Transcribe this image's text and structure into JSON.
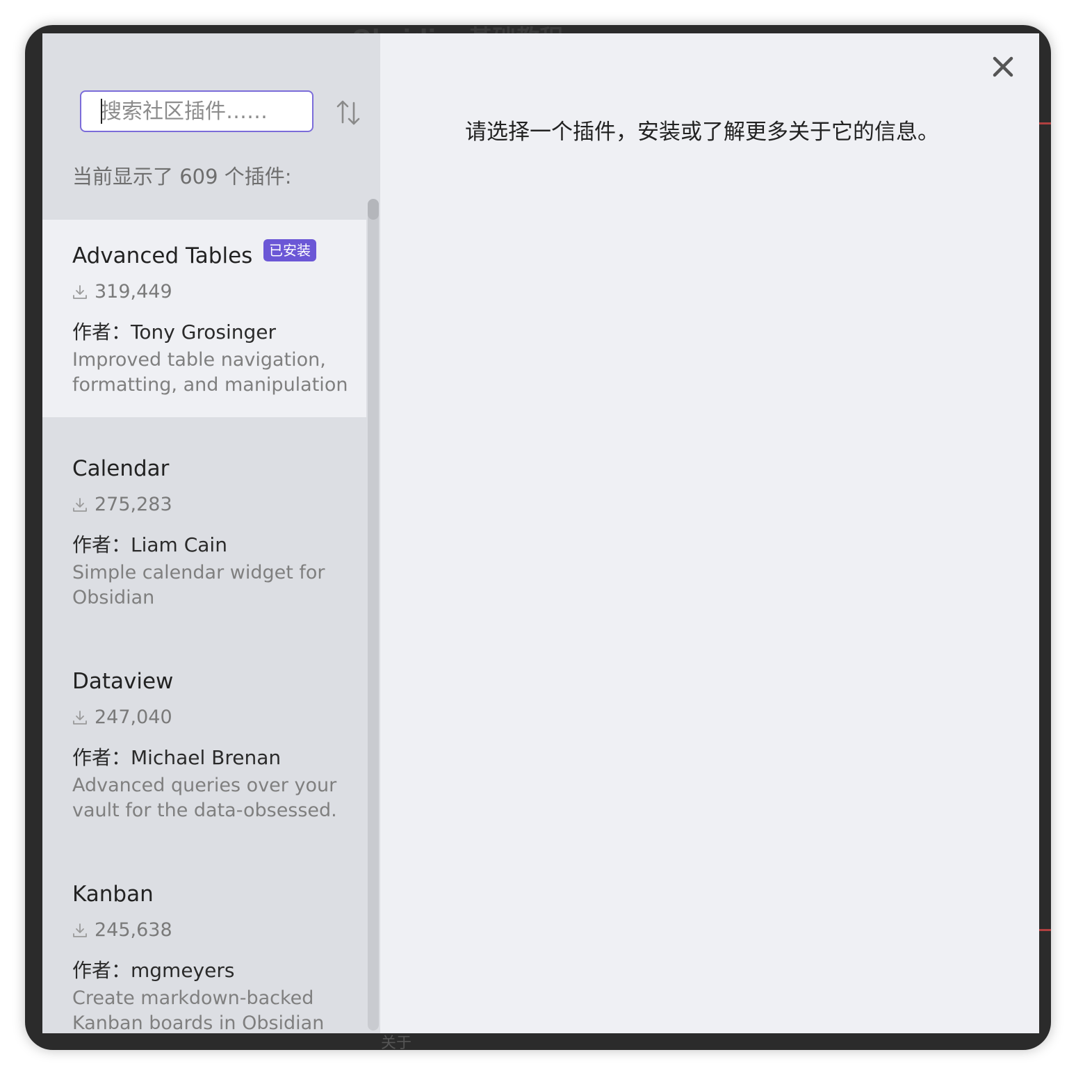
{
  "search": {
    "placeholder": "搜索社区插件……"
  },
  "list_count_text": "当前显示了 609 个插件:",
  "detail_prompt": "请选择一个插件，安装或了解更多关于它的信息。",
  "plugins": [
    {
      "name": "Advanced Tables",
      "badge": "已安装",
      "downloads": "319,449",
      "author": "作者：Tony Grosinger",
      "description": "Improved table navigation, formatting, and manipulation",
      "selected": true
    },
    {
      "name": "Calendar",
      "downloads": "275,283",
      "author": "作者：Liam Cain",
      "description": "Simple calendar widget for Obsidian"
    },
    {
      "name": "Dataview",
      "downloads": "247,040",
      "author": "作者：Michael Brenan",
      "description": "Advanced queries over your vault for the data-obsessed."
    },
    {
      "name": "Kanban",
      "downloads": "245,638",
      "author": "作者：mgmeyers",
      "description": "Create markdown-backed Kanban boards in Obsidian"
    }
  ],
  "background": {
    "title": "Obsidian基础教程",
    "bottom_label": "关于"
  },
  "colors": {
    "accent": "#7b6cd9",
    "badge": "#6b57d6",
    "sidebar_bg": "#dcdee3",
    "panel_bg": "#eff0f4"
  },
  "icons": {
    "sort": "sort-arrows-icon",
    "close": "close-icon",
    "download": "download-icon"
  }
}
